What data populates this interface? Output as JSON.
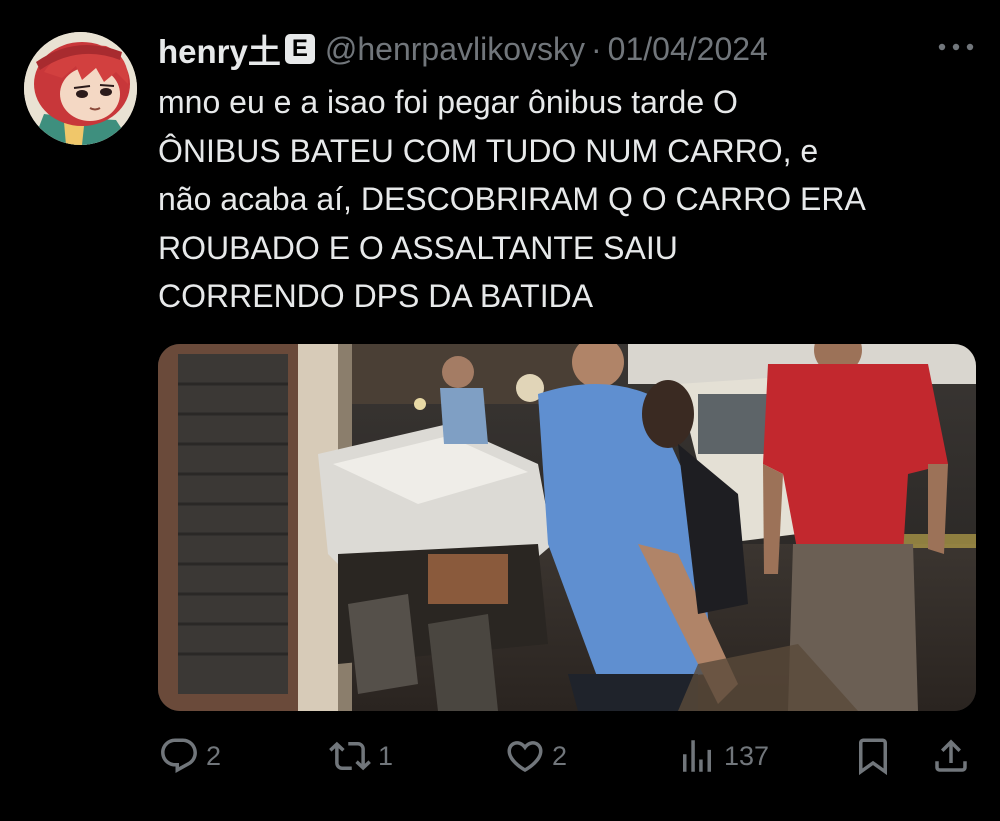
{
  "tweet": {
    "author": {
      "display_name": "henry土",
      "badge": "E",
      "handle": "@henrpavlikovsky",
      "avatar_icon": "anime-avatar-icon"
    },
    "separator": "·",
    "date": "01/04/2024",
    "more_icon": "more-icon",
    "text": "mno eu e a isao foi pegar ônibus tarde O\nÔNIBUS BATEU COM TUDO NUM CARRO, e\nnão acaba aí, DESCOBRIRAM Q O CARRO ERA\nROUBADO E O ASSALTANTE SAIU\nCORRENDO DPS DA BATIDA",
    "media_icon": "crashed-car-photo",
    "actions": {
      "reply": {
        "icon": "reply-icon",
        "count": "2"
      },
      "retweet": {
        "icon": "retweet-icon",
        "count": "1"
      },
      "like": {
        "icon": "heart-icon",
        "count": "2"
      },
      "views": {
        "icon": "views-icon",
        "count": "137"
      },
      "bookmark": {
        "icon": "bookmark-icon"
      },
      "share": {
        "icon": "share-icon"
      }
    }
  },
  "colors": {
    "background": "#000000",
    "text_primary": "#e7e9ea",
    "text_secondary": "#71767b"
  }
}
